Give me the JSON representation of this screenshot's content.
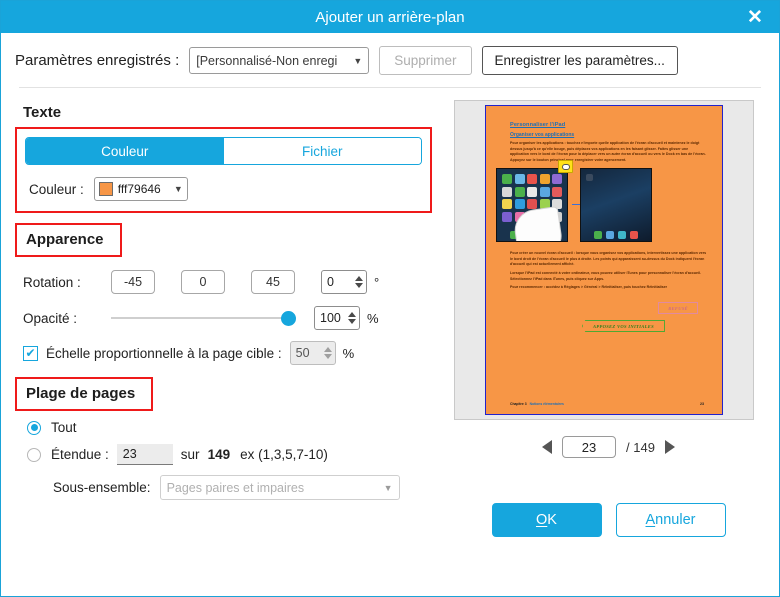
{
  "window": {
    "title": "Ajouter un arrière-plan",
    "close_icon": "close-icon",
    "accent_color": "#16a6dd"
  },
  "saved_settings": {
    "label": "Paramètres enregistrés :",
    "preset_value": "[Personnalisé-Non enregi",
    "delete_label": "Supprimer",
    "save_label": "Enregistrer les paramètres..."
  },
  "texte": {
    "section_title": "Texte",
    "tabs": [
      {
        "label": "Couleur",
        "active": true
      },
      {
        "label": "Fichier",
        "active": false
      }
    ],
    "color_label": "Couleur :",
    "color_value": "fff79646",
    "color_swatch": "#f79646"
  },
  "apparence": {
    "section_title": "Apparence",
    "rotation_label": "Rotation :",
    "rotation_presets": [
      "-45",
      "0",
      "45"
    ],
    "rotation_value": "0",
    "rotation_unit": "°",
    "opacity_label": "Opacité :",
    "opacity_value": "100",
    "opacity_unit": "%",
    "opacity_percent": 100,
    "scale_checkbox_checked": true,
    "scale_label": "Échelle proportionnelle à la page cible :",
    "scale_value": "50",
    "scale_unit": "%",
    "check_icon": "check-icon"
  },
  "plage": {
    "section_title": "Plage de pages",
    "all_label": "Tout",
    "all_selected": true,
    "range_label": "Étendue :",
    "range_value": "23",
    "range_of": "sur",
    "range_total": "149",
    "range_hint": "ex (1,3,5,7-10)",
    "subset_label": "Sous-ensemble:",
    "subset_value": "Pages paires et impaires"
  },
  "preview": {
    "page_background": "#f79646",
    "heading1": "Personnaliser l'iPad",
    "heading2": "Organiser vos applications",
    "paragraph1": "Pour organiser les applications : touchez n'importe quelle application de l'écran d'accueil et maintenez le doigt dessus jusqu'à ce qu'elle bouge, puis déplacez vos applications en les faisant glisser. Faites glisser une application vers le bord de l'écran pour la déplacer vers un autre écran d'accueil ou vers le Dock en bas de l'écran. Appuyez sur le bouton principal pour enregistrer votre agencement.",
    "paragraph2": "Pour créer un nouvel écran d'accueil : lorsque vous organisez vos applications, intervertissez une application vers le bord droit de l'écran d'accueil le plus à droite. Les points qui apparaissent au-dessus du Dock indiquent l'écran d'accueil qui est actuellement affiché.",
    "paragraph3": "Lorsque l'iPad est connecté à votre ordinateur, vous pouvez utiliser iTunes pour personnaliser l'écran d'accueil. Sélectionnez l'iPad dans iTunes, puis cliquez sur Apps.",
    "paragraph4": "Pour recommencer : accédez à Réglages > Général > Réinitialiser, puis touchez Réinitialiser",
    "stamp_refuse": "REFUSÉ",
    "stamp_initials": "APPOSEZ VOS INITIALES",
    "footer_chapter": "Chapitre 3",
    "footer_section": "Notions élémentaires",
    "footer_page": "23",
    "note_icon": "sticky-note-icon"
  },
  "pager": {
    "prev_icon": "prev-page-icon",
    "next_icon": "next-page-icon",
    "current_page": "23",
    "total_pages": "/ 149"
  },
  "actions": {
    "ok_first": "O",
    "ok_rest": "K",
    "cancel_first": "A",
    "cancel_rest": "nnuler"
  }
}
